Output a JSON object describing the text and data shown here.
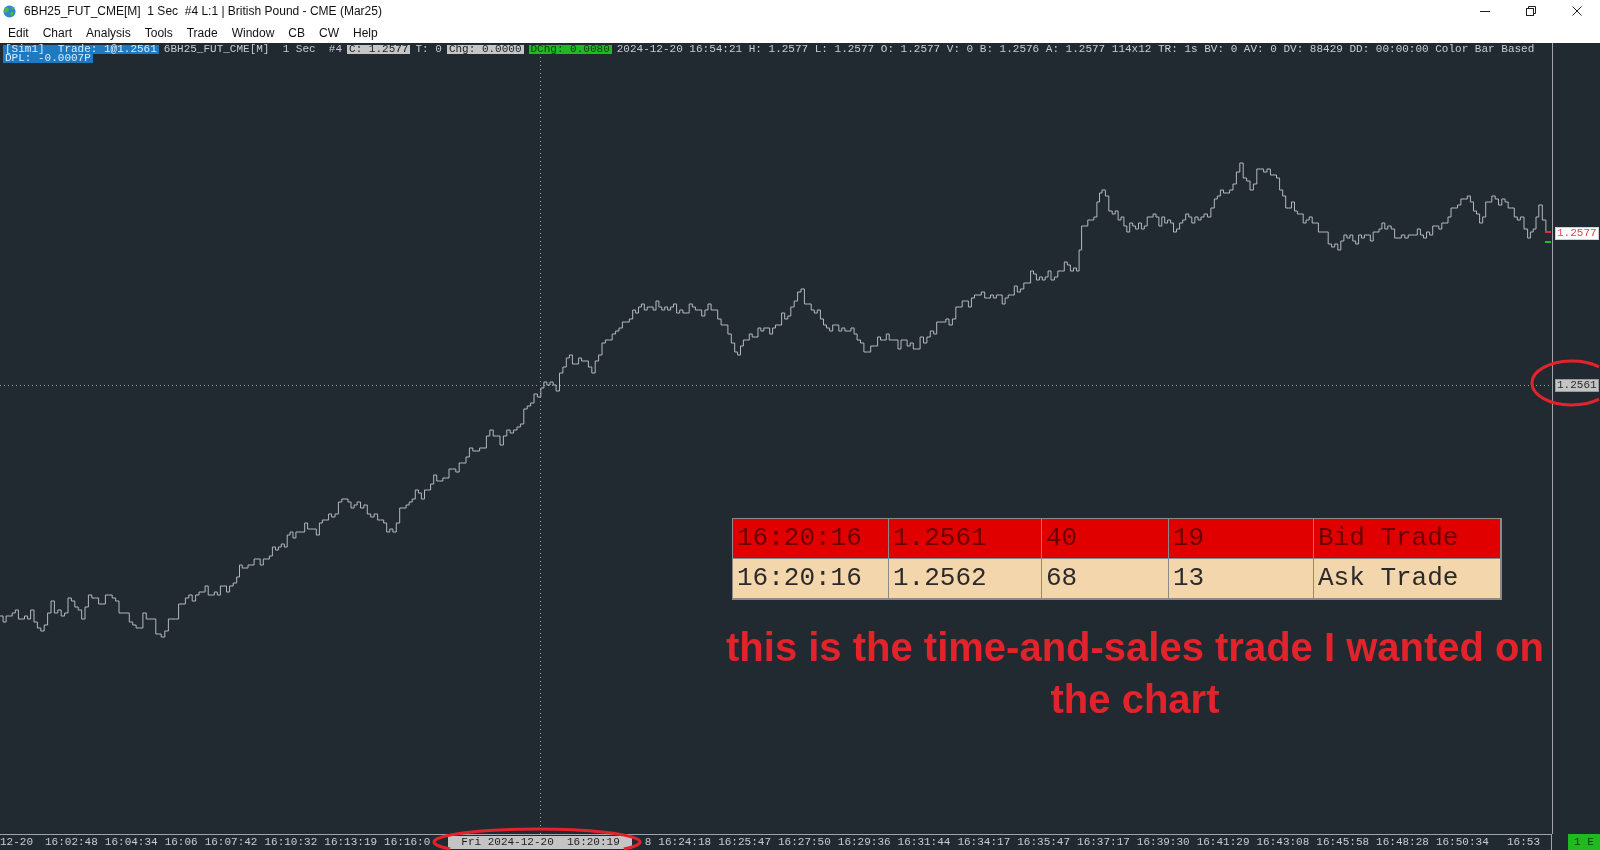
{
  "window": {
    "title": "6BH25_FUT_CME[M]  1 Sec  #4 L:1 | British Pound - CME (Mar25)"
  },
  "menu": [
    "Edit",
    "Chart",
    "Analysis",
    "Tools",
    "Trade",
    "Window",
    "CB",
    "CW",
    "Help"
  ],
  "chart": {
    "info_lines": [
      [
        {
          "text": "[Sim1]  Trade: 1@1.2561",
          "kind": "trade"
        },
        {
          "text": "6BH25_FUT_CME[M]  1 Sec  #4",
          "kind": "plain"
        },
        {
          "text": "C: 1.2577",
          "kind": "boxed"
        },
        {
          "text": "T: 0",
          "kind": "plain"
        },
        {
          "text": "Chg: 0.0000",
          "kind": "boxed"
        },
        {
          "text": "DChg: 0.0080",
          "kind": "gain"
        },
        {
          "text": "2024-12-20 16:54:21 H: 1.2577 L: 1.2577 O: 1.2577 V: 0 B: 1.2576 A: 1.2577 114x12 TR: 1s BV: 0 AV: 0 DV: 88429 DD: 00:00:00 Color Bar Based",
          "kind": "plain"
        }
      ],
      [
        {
          "text": "DPL: -0.0007P",
          "kind": "trade"
        }
      ]
    ],
    "price_labels": [
      {
        "text": "1.2577",
        "kind": "last"
      },
      {
        "text": "1.2561",
        "kind": "cursor"
      }
    ],
    "time_labels": [
      {
        "text": "12-20",
        "kind": "tick"
      },
      {
        "text": "16:02:48",
        "kind": "tick"
      },
      {
        "text": "16:04:34",
        "kind": "tick"
      },
      {
        "text": "16:06",
        "kind": "tick"
      },
      {
        "text": "16:07:42",
        "kind": "tick"
      },
      {
        "text": "16:10:32",
        "kind": "tick"
      },
      {
        "text": "16:13:19",
        "kind": "tick"
      },
      {
        "text": "16:16:0",
        "kind": "tick"
      },
      {
        "text": "Fri 2024-12-20  16:20:19",
        "kind": "cursor"
      },
      {
        "text": "8",
        "kind": "tick"
      },
      {
        "text": "16:24:18",
        "kind": "tick"
      },
      {
        "text": "16:25:47",
        "kind": "tick"
      },
      {
        "text": "16:27:50",
        "kind": "tick"
      },
      {
        "text": "16:29:36",
        "kind": "tick"
      },
      {
        "text": "16:31:44",
        "kind": "tick"
      },
      {
        "text": "16:34:17",
        "kind": "tick"
      },
      {
        "text": "16:35:47",
        "kind": "tick"
      },
      {
        "text": "16:37:17",
        "kind": "tick"
      },
      {
        "text": "16:39:30",
        "kind": "tick"
      },
      {
        "text": "16:41:29",
        "kind": "tick"
      },
      {
        "text": "16:43:08",
        "kind": "tick"
      },
      {
        "text": "16:45:58",
        "kind": "tick"
      },
      {
        "text": "16:48:28",
        "kind": "tick"
      },
      {
        "text": "16:50:34",
        "kind": "tick"
      },
      {
        "text": "16:53",
        "kind": "tick"
      }
    ],
    "corner_label": "1 E",
    "time_and_sales": [
      {
        "kind": "bid",
        "cells": [
          "16:20:16",
          "1.2561",
          "40",
          "19",
          "Bid Trade"
        ]
      },
      {
        "kind": "ask",
        "cells": [
          "16:20:16",
          "1.2562",
          "68",
          "13",
          "Ask Trade"
        ]
      }
    ],
    "annotation": "this is the time-and-sales trade I wanted on the chart"
  }
}
